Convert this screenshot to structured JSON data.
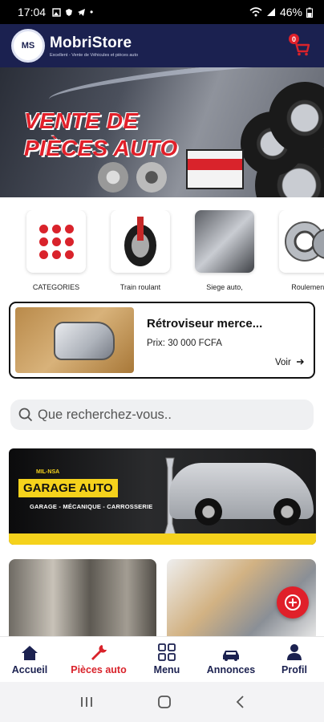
{
  "status_bar": {
    "time": "17:04",
    "battery": "46%"
  },
  "header": {
    "app_name": "MobriStore",
    "logo_text": "MS",
    "tagline": "Excellent - Vente de Véhicules et pièces auto",
    "cart_count": "0"
  },
  "banner": {
    "title": "VENTE DE\nPIÈCES AUTO"
  },
  "categories": [
    {
      "label": "CATEGORIES",
      "icon": "grid-dots-icon"
    },
    {
      "label": "Train roulant",
      "icon": "suspension-image"
    },
    {
      "label": "Siege auto,",
      "icon": "car-seat-image"
    },
    {
      "label": "Roulement",
      "icon": "bearing-image"
    }
  ],
  "featured_product": {
    "title": "Rétroviseur merce...",
    "price": "Prix: 30 000 FCFA",
    "link": "Voir"
  },
  "search": {
    "placeholder": "Que recherchez-vous.."
  },
  "garage_banner": {
    "small": "MIL-NSA",
    "title": "GARAGE AUTO",
    "subtitle": "GARAGE - MÉCANIQUE - CARROSSERIE"
  },
  "bottom_nav": [
    {
      "label": "Accueil",
      "icon": "home-icon"
    },
    {
      "label": "Pièces auto",
      "icon": "wrench-icon",
      "active": true
    },
    {
      "label": "Menu",
      "icon": "menu-grid-icon"
    },
    {
      "label": "Annonces",
      "icon": "car-icon"
    },
    {
      "label": "Profil",
      "icon": "user-icon"
    }
  ],
  "colors": {
    "navy": "#1b2150",
    "accent_red": "#d9232b",
    "yellow": "#f5d21c"
  }
}
